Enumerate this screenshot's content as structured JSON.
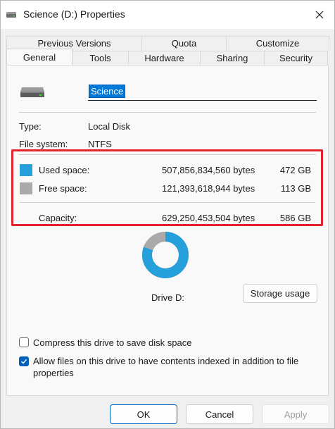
{
  "window": {
    "title": "Science (D:) Properties"
  },
  "tabs": {
    "back": [
      "Previous Versions",
      "Quota",
      "Customize"
    ],
    "front": [
      "General",
      "Tools",
      "Hardware",
      "Sharing",
      "Security"
    ],
    "active": "General"
  },
  "drive": {
    "name": "Science",
    "type_label": "Type:",
    "type_value": "Local Disk",
    "fs_label": "File system:",
    "fs_value": "NTFS"
  },
  "space": {
    "used_label": "Used space:",
    "used_bytes": "507,856,834,560 bytes",
    "used_gb": "472 GB",
    "free_label": "Free space:",
    "free_bytes": "121,393,618,944 bytes",
    "free_gb": "113 GB",
    "capacity_label": "Capacity:",
    "capacity_bytes": "629,250,453,504 bytes",
    "capacity_gb": "586 GB",
    "used_fraction": 0.807
  },
  "colors": {
    "used": "#26a0da",
    "free": "#aaaaaa",
    "highlight": "#e4242b",
    "accent": "#005fb8"
  },
  "chart": {
    "label": "Drive D:"
  },
  "storage_button": "Storage usage",
  "options": {
    "compress": {
      "label": "Compress this drive to save disk space",
      "checked": false
    },
    "index": {
      "label": "Allow files on this drive to have contents indexed in addition to file",
      "label2": "properties",
      "checked": true
    }
  },
  "buttons": {
    "ok": "OK",
    "cancel": "Cancel",
    "apply": "Apply"
  }
}
